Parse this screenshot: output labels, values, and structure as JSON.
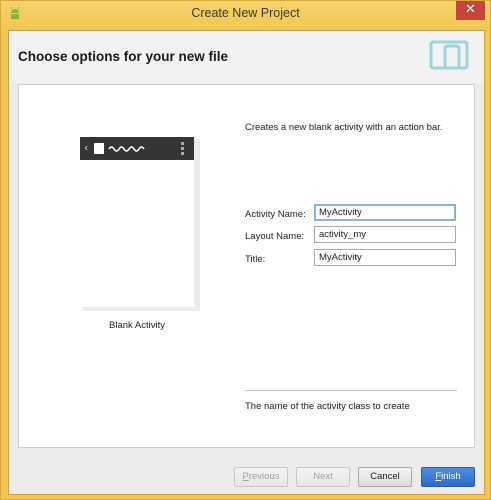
{
  "window": {
    "title": "Create New Project",
    "close_glyph": "✕",
    "app_icon": "android-icon"
  },
  "header": {
    "title": "Choose options for your new file",
    "graphic_icon": "device-icon"
  },
  "preview": {
    "back_glyph": "‹",
    "label": "Blank Activity"
  },
  "form": {
    "description": "Creates a new blank activity with an action bar.",
    "fields": [
      {
        "label": "Activity Name:",
        "value": "MyActivity"
      },
      {
        "label": "Layout Name:",
        "value": "activity_my"
      },
      {
        "label": "Title:",
        "value": "MyActivity"
      }
    ],
    "help_text": "The name of the activity class to create"
  },
  "buttons": {
    "previous": {
      "first": "P",
      "rest": "revious"
    },
    "next": "Next",
    "cancel": "Cancel",
    "finish": {
      "first": "F",
      "rest": "inish"
    }
  },
  "colors": {
    "title_bar": "#f3cc5f",
    "close_button": "#c7463a",
    "primary_button": "#2a6bcc"
  }
}
